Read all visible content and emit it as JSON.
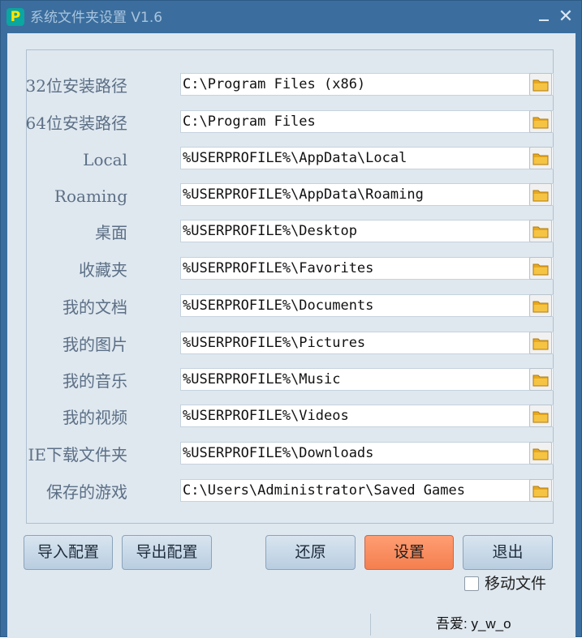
{
  "window": {
    "title": "系统文件夹设置 V1.6",
    "app_icon_letter": "P",
    "minimize_symbol": "—",
    "close_symbol": "✕"
  },
  "paths": [
    {
      "label": "32位安装路径",
      "value": "C:\\Program Files (x86)"
    },
    {
      "label": "64位安装路径",
      "value": "C:\\Program Files"
    },
    {
      "label": "Local",
      "value": "%USERPROFILE%\\AppData\\Local"
    },
    {
      "label": "Roaming",
      "value": "%USERPROFILE%\\AppData\\Roaming"
    },
    {
      "label": "桌面",
      "value": "%USERPROFILE%\\Desktop"
    },
    {
      "label": "收藏夹",
      "value": "%USERPROFILE%\\Favorites"
    },
    {
      "label": "我的文档",
      "value": "%USERPROFILE%\\Documents"
    },
    {
      "label": "我的图片",
      "value": "%USERPROFILE%\\Pictures"
    },
    {
      "label": "我的音乐",
      "value": "%USERPROFILE%\\Music"
    },
    {
      "label": "我的视频",
      "value": "%USERPROFILE%\\Videos"
    },
    {
      "label": "IE下载文件夹",
      "value": "%USERPROFILE%\\Downloads"
    },
    {
      "label": "保存的游戏",
      "value": "C:\\Users\\Administrator\\Saved Games"
    }
  ],
  "buttons": {
    "import": "导入配置",
    "export": "导出配置",
    "restore": "还原",
    "apply": "设置",
    "exit": "退出"
  },
  "move_files": {
    "label": "移动文件",
    "checked": false
  },
  "status": {
    "credit": "吾爱: y_w_o"
  },
  "icons": {
    "folder": "folder-icon"
  },
  "colors": {
    "titlebar": "#3b6e9e",
    "client": "#dfe8ef",
    "label": "#5c6f86",
    "primary_button": "#f47f4f",
    "folder": "#f6c443"
  }
}
